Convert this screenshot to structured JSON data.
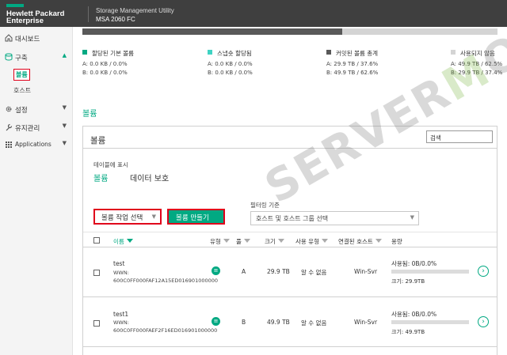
{
  "header": {
    "brand_line1": "Hewlett Packard",
    "brand_line2": "Enterprise",
    "product_line1": "Storage Management Utility",
    "product_line2": "MSA 2060 FC"
  },
  "sidebar": {
    "items": [
      {
        "label": "대시보드",
        "icon": "dashboard-icon"
      },
      {
        "label": "구축",
        "icon": "database-icon",
        "caret": "▲"
      },
      {
        "label": "설정",
        "icon": "gear-icon",
        "caret": "▼"
      },
      {
        "label": "유지관리",
        "icon": "wrench-icon",
        "caret": "▼"
      },
      {
        "label": "Applications",
        "icon": "grid-icon",
        "caret": "▼"
      }
    ],
    "sub_items": [
      {
        "label": "볼륨",
        "active": true
      },
      {
        "label": "호스트",
        "active": false
      }
    ]
  },
  "capacity_bar": {
    "used_fraction": 0.626
  },
  "legend": [
    {
      "title": "할당된 기본 볼륨",
      "color": "#01a982",
      "a": "A: 0.0 KB / 0.0%",
      "b": "B: 0.0 KB / 0.0%"
    },
    {
      "title": "스냅숏 할당됨",
      "color": "#3fd3c3",
      "a": "A: 0.0 KB / 0.0%",
      "b": "B: 0.0 KB / 0.0%"
    },
    {
      "title": "커밋된 볼륨 총계",
      "color": "#595959",
      "a": "A: 29.9 TB / 37.6%",
      "b": "B: 49.9 TB / 62.6%"
    },
    {
      "title": "사용되지 않음",
      "color": "#d4d4d4",
      "a": "A: 49.9 TB / 62.5%",
      "b": "B: 29.9 TB / 37.4%"
    }
  ],
  "section_title": "볼륨",
  "panel": {
    "title": "볼륨",
    "search_value": "검색",
    "table_display_label": "테이블에 표시",
    "tabs": [
      "볼륨",
      "데이터 보호"
    ],
    "bulk_action": "볼륨 작업 선택",
    "create_button": "볼륨 만들기",
    "filter_label": "필터링 기준",
    "filter_value": "호스트 및 호스트 그룹 선택"
  },
  "table": {
    "headers": [
      "이름",
      "유형",
      "풀",
      "크기",
      "사용 유형",
      "연결된 호스트",
      "용량"
    ],
    "rows": [
      {
        "name": "test",
        "wwn_label": "WWN:",
        "wwn": "600C0FF000FAF12A15ED016901000000",
        "pool": "A",
        "size": "29.9 TB",
        "usage_type": "알 수 없음",
        "host": "Win-Svr",
        "used": "사용됨: 0B/0.0%",
        "used_fraction": 0.0,
        "capacity": "크기: 29.9TB"
      },
      {
        "name": "test1",
        "wwn_label": "WWN:",
        "wwn": "600C0FF000FAEF2F16ED016901000000",
        "pool": "B",
        "size": "49.9 TB",
        "usage_type": "알 수 없음",
        "host": "Win-Svr",
        "used": "사용됨: 0B/0.0%",
        "used_fraction": 0.0,
        "capacity": "크기: 49.9TB"
      }
    ]
  }
}
